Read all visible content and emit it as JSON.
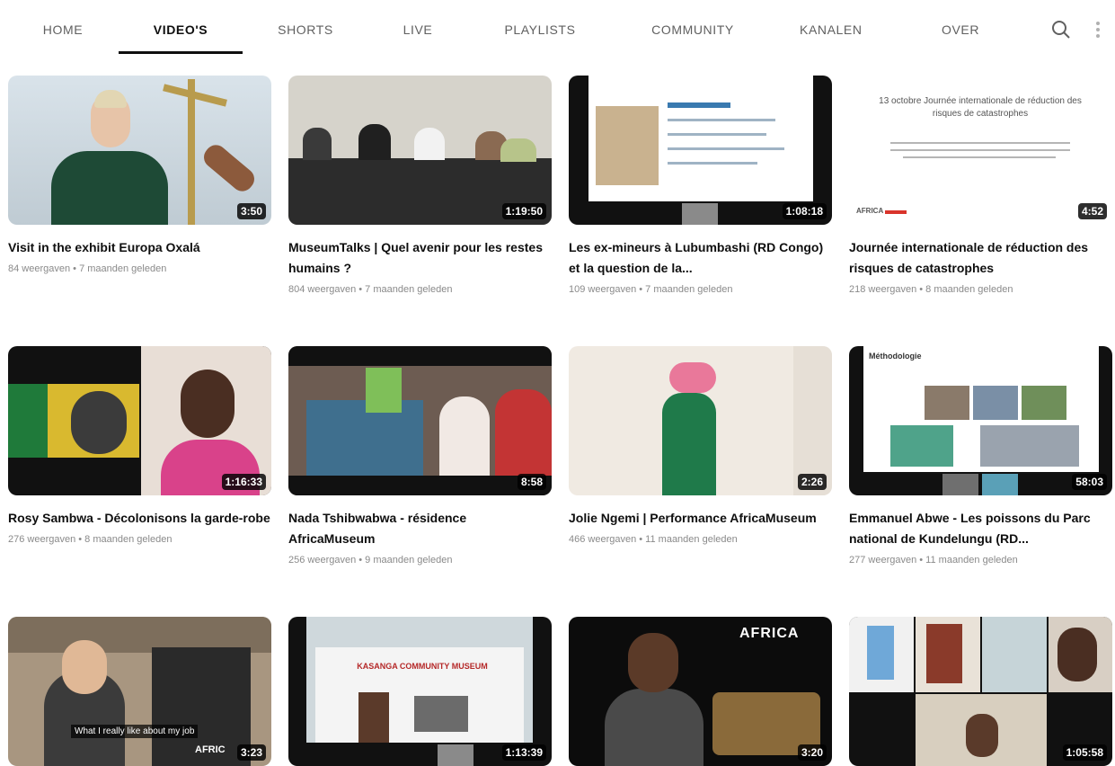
{
  "tabs": {
    "items": [
      "HOME",
      "VIDEO'S",
      "SHORTS",
      "LIVE",
      "PLAYLISTS",
      "COMMUNITY",
      "KANALEN",
      "OVER"
    ],
    "active": "VIDEO'S"
  },
  "icons": {
    "search": "search-icon",
    "more": "more-vert-icon"
  },
  "videos": [
    {
      "title": "Visit in the exhibit Europa Oxalá",
      "meta": "84 weergaven • 7 maanden geleden",
      "duration": "3:50"
    },
    {
      "title": "MuseumTalks | Quel avenir pour les restes humains ?",
      "meta": "804 weergaven • 7 maanden geleden",
      "duration": "1:19:50"
    },
    {
      "title": "Les ex-mineurs à Lubumbashi (RD Congo) et la question de la...",
      "meta": "109 weergaven • 7 maanden geleden",
      "duration": "1:08:18"
    },
    {
      "title": "Journée internationale de réduction des risques de catastrophes",
      "meta": "218 weergaven • 8 maanden geleden",
      "duration": "4:52",
      "thumb_text": {
        "heading": "13 octobre Journée internationale de réduction des risques de catastrophes",
        "logo": "AFRICA"
      }
    },
    {
      "title": "Rosy Sambwa - Décolonisons la garde-robe",
      "meta": "276 weergaven • 8 maanden geleden",
      "duration": "1:16:33"
    },
    {
      "title": "Nada Tshibwabwa - résidence AfricaMuseum",
      "meta": "256 weergaven • 9 maanden geleden",
      "duration": "8:58"
    },
    {
      "title": "Jolie Ngemi | Performance AfricaMuseum",
      "meta": "466 weergaven • 11 maanden geleden",
      "duration": "2:26"
    },
    {
      "title": "Emmanuel Abwe - Les poissons du Parc national de Kundelungu (RD...",
      "meta": "277 weergaven • 11 maanden geleden",
      "duration": "58:03",
      "thumb_text": {
        "heading": "Méthodologie"
      }
    },
    {
      "title": "",
      "meta": "",
      "duration": "3:23",
      "thumb_text": {
        "caption": "What I really like about my job",
        "logo": "AFRIC"
      }
    },
    {
      "title": "",
      "meta": "",
      "duration": "1:13:39",
      "thumb_text": {
        "sign": "KASANGA COMMUNITY MUSEUM"
      }
    },
    {
      "title": "",
      "meta": "",
      "duration": "3:20",
      "thumb_text": {
        "logo": "AFRICA"
      }
    },
    {
      "title": "",
      "meta": "",
      "duration": "1:05:58"
    }
  ]
}
